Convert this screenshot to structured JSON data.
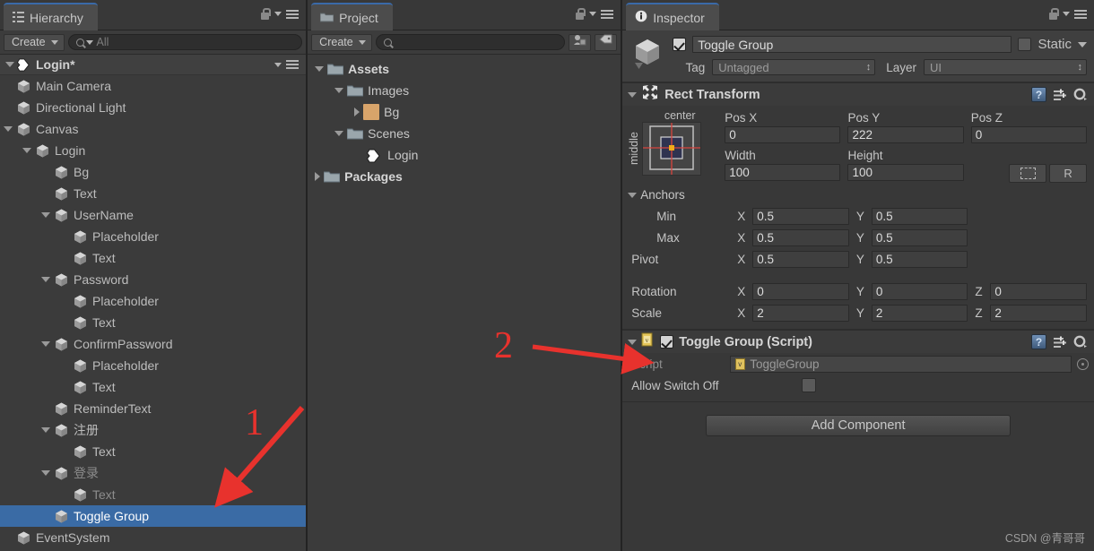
{
  "hierarchy": {
    "tab_label": "Hierarchy",
    "create_label": "Create",
    "search_placeholder": "All",
    "scene_name": "Login*",
    "items": [
      {
        "label": "Main Camera",
        "depth": 1,
        "arrow": "none",
        "dim": false,
        "selected": false
      },
      {
        "label": "Directional Light",
        "depth": 1,
        "arrow": "none",
        "dim": false,
        "selected": false
      },
      {
        "label": "Canvas",
        "depth": 1,
        "arrow": "down",
        "dim": false,
        "selected": false
      },
      {
        "label": "Login",
        "depth": 2,
        "arrow": "down",
        "dim": false,
        "selected": false
      },
      {
        "label": "Bg",
        "depth": 3,
        "arrow": "none",
        "dim": false,
        "selected": false
      },
      {
        "label": "Text",
        "depth": 3,
        "arrow": "none",
        "dim": false,
        "selected": false
      },
      {
        "label": "UserName",
        "depth": 3,
        "arrow": "down",
        "dim": false,
        "selected": false
      },
      {
        "label": "Placeholder",
        "depth": 4,
        "arrow": "none",
        "dim": false,
        "selected": false
      },
      {
        "label": "Text",
        "depth": 4,
        "arrow": "none",
        "dim": false,
        "selected": false
      },
      {
        "label": "Password",
        "depth": 3,
        "arrow": "down",
        "dim": false,
        "selected": false
      },
      {
        "label": "Placeholder",
        "depth": 4,
        "arrow": "none",
        "dim": false,
        "selected": false
      },
      {
        "label": "Text",
        "depth": 4,
        "arrow": "none",
        "dim": false,
        "selected": false
      },
      {
        "label": "ConfirmPassword",
        "depth": 3,
        "arrow": "down",
        "dim": false,
        "selected": false
      },
      {
        "label": "Placeholder",
        "depth": 4,
        "arrow": "none",
        "dim": false,
        "selected": false
      },
      {
        "label": "Text",
        "depth": 4,
        "arrow": "none",
        "dim": false,
        "selected": false
      },
      {
        "label": "ReminderText",
        "depth": 3,
        "arrow": "none",
        "dim": false,
        "selected": false
      },
      {
        "label": "注册",
        "depth": 3,
        "arrow": "down",
        "dim": false,
        "selected": false
      },
      {
        "label": "Text",
        "depth": 4,
        "arrow": "none",
        "dim": false,
        "selected": false
      },
      {
        "label": "登录",
        "depth": 3,
        "arrow": "down",
        "dim": true,
        "selected": false
      },
      {
        "label": "Text",
        "depth": 4,
        "arrow": "none",
        "dim": true,
        "selected": false
      },
      {
        "label": "Toggle Group",
        "depth": 3,
        "arrow": "none",
        "dim": false,
        "selected": true
      },
      {
        "label": "EventSystem",
        "depth": 1,
        "arrow": "none",
        "dim": false,
        "selected": false
      }
    ]
  },
  "project": {
    "tab_label": "Project",
    "create_label": "Create",
    "search_placeholder": "",
    "items": [
      {
        "label": "Assets",
        "depth": 0,
        "arrow": "down",
        "icon": "folder",
        "bold": true
      },
      {
        "label": "Images",
        "depth": 1,
        "arrow": "down",
        "icon": "folder",
        "bold": false
      },
      {
        "label": "Bg",
        "depth": 2,
        "arrow": "right",
        "icon": "image",
        "bold": false
      },
      {
        "label": "Scenes",
        "depth": 1,
        "arrow": "down",
        "icon": "folder",
        "bold": false
      },
      {
        "label": "Login",
        "depth": 2,
        "arrow": "none",
        "icon": "unity",
        "bold": false
      },
      {
        "label": "Packages",
        "depth": 0,
        "arrow": "right",
        "icon": "folder",
        "bold": true
      }
    ]
  },
  "inspector": {
    "tab_label": "Inspector",
    "object_name": "Toggle Group",
    "object_enabled": true,
    "static_label": "Static",
    "static_checked": false,
    "tag_label": "Tag",
    "tag_value": "Untagged",
    "layer_label": "Layer",
    "layer_value": "UI",
    "rect_transform": {
      "title": "Rect Transform",
      "anchor_preset_top": "center",
      "anchor_preset_left": "middle",
      "pos_x_label": "Pos X",
      "pos_x": "0",
      "pos_y_label": "Pos Y",
      "pos_y": "222",
      "pos_z_label": "Pos Z",
      "pos_z": "0",
      "width_label": "Width",
      "width": "100",
      "height_label": "Height",
      "height": "100",
      "blueprint_label": "",
      "rawedit_label": "R",
      "anchors_label": "Anchors",
      "min_label": "Min",
      "min_x": "0.5",
      "min_y": "0.5",
      "max_label": "Max",
      "max_x": "0.5",
      "max_y": "0.5",
      "pivot_label": "Pivot",
      "pivot_x": "0.5",
      "pivot_y": "0.5",
      "rotation_label": "Rotation",
      "rot_x": "0",
      "rot_y": "0",
      "rot_z": "0",
      "scale_label": "Scale",
      "scale_x": "2",
      "scale_y": "2",
      "scale_z": "2",
      "axis_x": "X",
      "axis_y": "Y",
      "axis_z": "Z"
    },
    "toggle_group": {
      "title": "Toggle Group (Script)",
      "enabled": true,
      "script_label": "Script",
      "script_value": "ToggleGroup",
      "allow_switch_off_label": "Allow Switch Off",
      "allow_switch_off": false
    },
    "add_component_label": "Add Component"
  },
  "annotations": {
    "marker_1": "1",
    "marker_2": "2"
  },
  "watermark": "CSDN @青哥哥",
  "colors": {
    "selection_blue": "#3a6ba5",
    "annotation_red": "#e8322d",
    "panel_bg": "#383838",
    "tree_bg": "#3b3b3b"
  }
}
